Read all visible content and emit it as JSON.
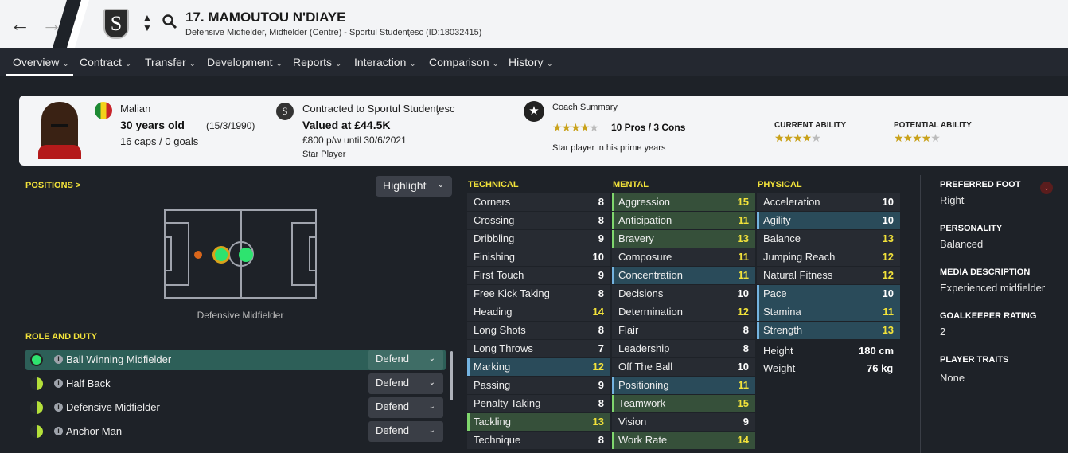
{
  "header": {
    "title": "17. MAMOUTOU N'DIAYE",
    "subtitle": "Defensive Midfielder, Midfielder (Centre) - Sportul Studenţesc (ID:18032415)",
    "back_glyph": "←",
    "forward_glyph": "→",
    "club_crest_icon": "sportul-crest",
    "sort_glyph": "⌃⌄",
    "search_glyph": "⚲"
  },
  "nav": {
    "chevron": "⌄",
    "items": [
      "Overview",
      "Contract",
      "Transfer",
      "Development",
      "Reports",
      "Interaction",
      "Comparison",
      "History"
    ]
  },
  "info_card": {
    "nationality": "Malian",
    "age": "30 years old",
    "dob": "(15/3/1990)",
    "caps": "16 caps / 0 goals",
    "contracted_to": "Contracted to Sportul Studenţesc",
    "value": "Valued at £44.5K",
    "wage": "£800 p/w until 30/6/2021",
    "status": "Star Player",
    "coach_summary_label": "Coach Summary",
    "pros_cons": "10 Pros / 3 Cons",
    "coach_line": "Star player in his prime years",
    "coach_stars": 4.5,
    "current_ability_label": "CURRENT ABILITY",
    "current_ability_stars": 4.5,
    "potential_ability_label": "POTENTIAL ABILITY",
    "potential_ability_stars": 4.5
  },
  "positions": {
    "label": "POSITIONS >",
    "highlight_label": "Highlight",
    "position_name": "Defensive Midfielder"
  },
  "role_and_duty": {
    "label": "ROLE AND DUTY",
    "info_glyph": "i",
    "roles": [
      {
        "name": "Ball Winning Midfielder",
        "duty": "Defend",
        "selected": true
      },
      {
        "name": "Half Back",
        "duty": "Defend",
        "selected": false
      },
      {
        "name": "Defensive Midfielder",
        "duty": "Defend",
        "selected": false
      },
      {
        "name": "Anchor Man",
        "duty": "Defend",
        "selected": false
      }
    ]
  },
  "technical": {
    "label": "TECHNICAL",
    "rows": [
      {
        "name": "Corners",
        "value": "8",
        "style": ""
      },
      {
        "name": "Crossing",
        "value": "8",
        "style": ""
      },
      {
        "name": "Dribbling",
        "value": "9",
        "style": ""
      },
      {
        "name": "Finishing",
        "value": "10",
        "style": ""
      },
      {
        "name": "First Touch",
        "value": "9",
        "style": ""
      },
      {
        "name": "Free Kick Taking",
        "value": "8",
        "style": ""
      },
      {
        "name": "Heading",
        "value": "14",
        "style": "y"
      },
      {
        "name": "Long Shots",
        "value": "8",
        "style": ""
      },
      {
        "name": "Long Throws",
        "value": "7",
        "style": ""
      },
      {
        "name": "Marking",
        "value": "12",
        "style": "hi y"
      },
      {
        "name": "Passing",
        "value": "9",
        "style": ""
      },
      {
        "name": "Penalty Taking",
        "value": "8",
        "style": ""
      },
      {
        "name": "Tackling",
        "value": "13",
        "style": "gr y"
      },
      {
        "name": "Technique",
        "value": "8",
        "style": ""
      }
    ]
  },
  "mental": {
    "label": "MENTAL",
    "rows": [
      {
        "name": "Aggression",
        "value": "15",
        "style": "gr y"
      },
      {
        "name": "Anticipation",
        "value": "11",
        "style": "gr y"
      },
      {
        "name": "Bravery",
        "value": "13",
        "style": "gr y"
      },
      {
        "name": "Composure",
        "value": "11",
        "style": "y"
      },
      {
        "name": "Concentration",
        "value": "11",
        "style": "hi y"
      },
      {
        "name": "Decisions",
        "value": "10",
        "style": ""
      },
      {
        "name": "Determination",
        "value": "12",
        "style": "y"
      },
      {
        "name": "Flair",
        "value": "8",
        "style": ""
      },
      {
        "name": "Leadership",
        "value": "8",
        "style": ""
      },
      {
        "name": "Off The Ball",
        "value": "10",
        "style": ""
      },
      {
        "name": "Positioning",
        "value": "11",
        "style": "hi y"
      },
      {
        "name": "Teamwork",
        "value": "15",
        "style": "gr y"
      },
      {
        "name": "Vision",
        "value": "9",
        "style": ""
      },
      {
        "name": "Work Rate",
        "value": "14",
        "style": "gr y"
      }
    ]
  },
  "physical": {
    "label": "PHYSICAL",
    "rows": [
      {
        "name": "Acceleration",
        "value": "10",
        "style": ""
      },
      {
        "name": "Agility",
        "value": "10",
        "style": "hi"
      },
      {
        "name": "Balance",
        "value": "13",
        "style": "y"
      },
      {
        "name": "Jumping Reach",
        "value": "12",
        "style": "y"
      },
      {
        "name": "Natural Fitness",
        "value": "12",
        "style": "y"
      },
      {
        "name": "Pace",
        "value": "10",
        "style": "hi"
      },
      {
        "name": "Stamina",
        "value": "11",
        "style": "hi y"
      },
      {
        "name": "Strength",
        "value": "13",
        "style": "hi y"
      }
    ],
    "height_label": "Height",
    "height_value": "180 cm",
    "weight_label": "Weight",
    "weight_value": "76 kg"
  },
  "details": {
    "preferred_foot_label": "PREFERRED FOOT",
    "preferred_foot": "Right",
    "collapse_glyph": "⌄",
    "personality_label": "PERSONALITY",
    "personality": "Balanced",
    "media_label": "MEDIA DESCRIPTION",
    "media": "Experienced midfielder",
    "gk_label": "GOALKEEPER RATING",
    "gk": "2",
    "traits_label": "PLAYER TRAITS",
    "traits": "None"
  },
  "colors": {
    "accent_yellow": "#f2e23a",
    "highlight_blue": "#2a4b5a",
    "highlight_green": "#36503a",
    "selected_role": "#2d5f58",
    "position_natural": "#2ee36f",
    "position_secondary": "#d9661b"
  }
}
